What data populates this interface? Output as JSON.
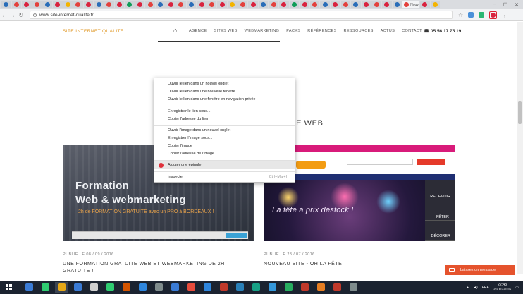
{
  "browser": {
    "tab_favicon_colors": [
      "#2a6db8",
      "#e3413d",
      "#d9233f",
      "#e3413d",
      "#2a6db8",
      "#d9233f",
      "#f4b400",
      "#e3413d",
      "#d9233f",
      "#2a6db8",
      "#e3413d",
      "#d9233f",
      "#0f9d58",
      "#d9233f",
      "#e3413d",
      "#2a6db8",
      "#d9233f",
      "#e3413d",
      "#2a6db8",
      "#d9233f",
      "#e3413d",
      "#d9233f",
      "#f4b400",
      "#e3413d",
      "#d9233f",
      "#2a6db8",
      "#e3413d",
      "#d9233f",
      "#0f9d58",
      "#d9233f",
      "#e3413d",
      "#2a6db8",
      "#d9233f",
      "#e3413d",
      "#2a6db8",
      "#d9233f",
      "#e3413d",
      "#d9233f",
      "#2a6db8",
      "#e3413d",
      "#d9233f",
      "#f4b400"
    ],
    "active_tab_index": 39,
    "active_tab_title": "Nouv",
    "url": "www.site-internet-qualite.fr"
  },
  "site": {
    "logo": "SITE INTERNET QUALITE",
    "nav": [
      "AGENCE",
      "SITES WEB",
      "WEBMARKETING",
      "PACKS",
      "RÉFÉRENCES",
      "RESSOURCES",
      "ACTUS",
      "CONTACT"
    ],
    "phone": "05.56.17.75.19",
    "section_title": "NCE WEB"
  },
  "posts": [
    {
      "image_line1": "Formation",
      "image_line2": "Web & webmarketing",
      "image_line3": "2h de FORMATION GRATUITE avec un PRO à BORDEAUX !",
      "meta": "PUBLIÉ LE 08 / 09 / 2016",
      "title_line1": "UNE FORMATION GRATUITE WEB ET WEBMARKETING DE 2H",
      "title_line2": "GRATUITE !"
    },
    {
      "image_hero": "La fête à prix déstock !",
      "image_side": [
        "RECEVOIR",
        "FÊTER",
        "DÉCORER"
      ],
      "meta": "PUBLIÉ LE 28 / 07 / 2016",
      "title_line1": "NOUVEAU SITE - OH LA FÊTE"
    }
  ],
  "context_menu": {
    "items": [
      "Ouvrir le lien dans un nouvel onglet",
      "Ouvrir le lien dans une nouvelle fenêtre",
      "Ouvrir le lien dans une fenêtre en navigation privée",
      "Enregistrer le lien sous...",
      "Copier l'adresse du lien",
      "Ouvrir l'image dans un nouvel onglet",
      "Enregistrer l'image sous...",
      "Copier l'image",
      "Copier l'adresse de l'image",
      "Ajouter une épingle",
      "Inspecter"
    ],
    "inspect_shortcut": "Ctrl+Maj+I"
  },
  "chat_label": "Laissez un message",
  "taskbar": {
    "app_colors": [
      "#3a7bd5",
      "#2ecc71",
      "#e6a817",
      "#3a7bd5",
      "#cfcfcf",
      "#2ecc71",
      "#d35400",
      "#2e86de",
      "#7f8c8d",
      "#3a7bd5",
      "#e74c3c",
      "#2e86de",
      "#c0392b",
      "#2980b9",
      "#16a085",
      "#3498db",
      "#27ae60",
      "#c0392b",
      "#e67e22",
      "#c0392b",
      "#7f8c8d"
    ],
    "active_index": 2,
    "lang": "FRA",
    "time": "22:43",
    "date": "20/11/2016"
  },
  "colors": {
    "accent_orange": "#e09a2a",
    "pin_red": "#d9233f",
    "chat_orange": "#e5532d",
    "taskbar": "#1b2330"
  }
}
